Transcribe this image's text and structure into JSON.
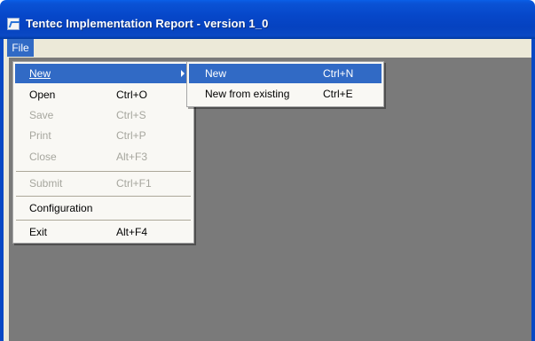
{
  "window": {
    "title": "Tentec Implementation Report - version 1_0"
  },
  "menubar": {
    "file_label": "File"
  },
  "file_menu": {
    "items": [
      {
        "label": "New",
        "shortcut": "",
        "state": "highlighted",
        "has_submenu": true
      },
      {
        "label": "Open",
        "shortcut": "Ctrl+O",
        "state": "enabled"
      },
      {
        "label": "Save",
        "shortcut": "Ctrl+S",
        "state": "disabled"
      },
      {
        "label": "Print",
        "shortcut": "Ctrl+P",
        "state": "disabled"
      },
      {
        "label": "Close",
        "shortcut": "Alt+F3",
        "state": "disabled"
      },
      {
        "label": "Submit",
        "shortcut": "Ctrl+F1",
        "state": "disabled"
      },
      {
        "label": "Configuration",
        "shortcut": "",
        "state": "enabled"
      },
      {
        "label": "Exit",
        "shortcut": "Alt+F4",
        "state": "enabled"
      }
    ]
  },
  "new_submenu": {
    "items": [
      {
        "label": "New",
        "shortcut": "Ctrl+N",
        "state": "highlighted"
      },
      {
        "label": "New from existing",
        "shortcut": "Ctrl+E",
        "state": "enabled"
      }
    ]
  },
  "icons": {
    "app": "app-logo-icon",
    "submenu_arrow": "submenu-arrow-icon"
  },
  "colors": {
    "titlebar": "#0a49c4",
    "highlight": "#316ac5",
    "client_background": "#7a7a7a",
    "menu_background": "#f9f8f4",
    "disabled_text": "#a6a69e"
  }
}
